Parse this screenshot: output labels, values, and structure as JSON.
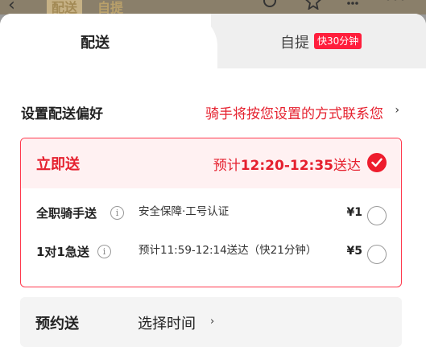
{
  "topbar": {
    "back_icon": "‹",
    "ghost_tab_1": "配送",
    "ghost_tab_2": "自提"
  },
  "tabs": {
    "delivery_label": "配送",
    "pickup_label": "自提",
    "pickup_badge": "快30分钟"
  },
  "preference": {
    "title": "设置配送偏好",
    "hint": "骑手将按您设置的方式联系您",
    "arrow": "›"
  },
  "instant": {
    "title": "立即送",
    "eta_prefix": "预计",
    "eta_time": "12:20-12:35",
    "eta_suffix": "送达",
    "options": [
      {
        "name": "全职骑手送",
        "desc": "安全保障·工号认证",
        "price": "¥1"
      },
      {
        "name": "1对1急送",
        "desc": "预计11:59-12:14送达（快21分钟）",
        "price": "¥5"
      }
    ]
  },
  "scheduled": {
    "title": "预约送",
    "pick_label": "选择时间",
    "arrow": "›"
  },
  "colors": {
    "accent_red": "#e5202e",
    "badge_red": "#ff1e3c",
    "selected_bg": "#fff1f2"
  }
}
